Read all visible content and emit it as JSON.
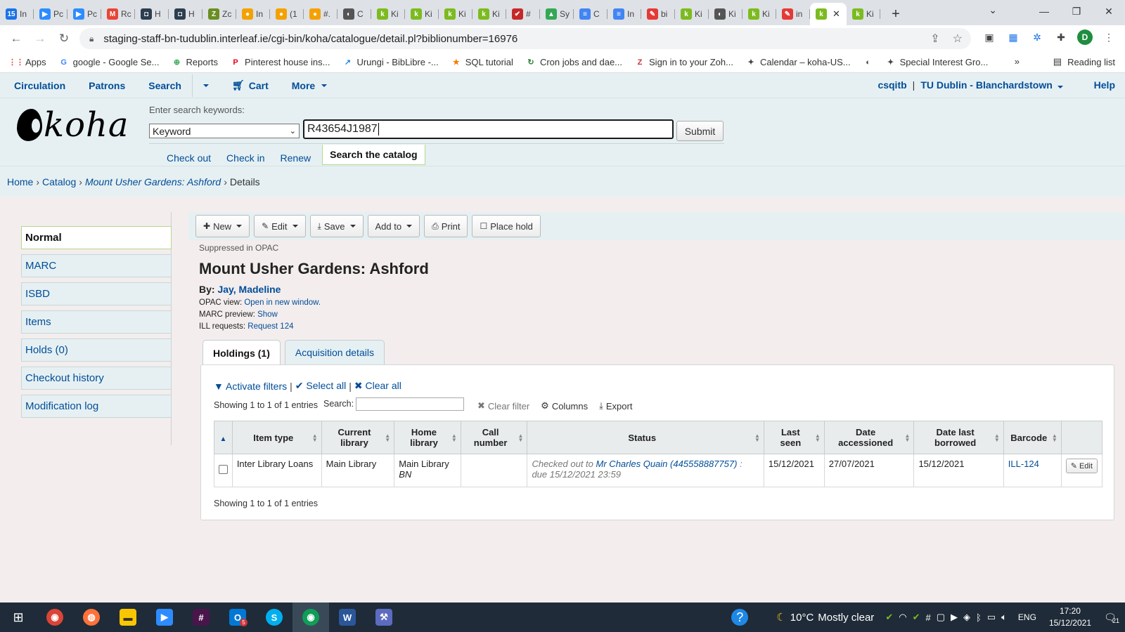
{
  "browser": {
    "tabs": [
      {
        "label": "In",
        "icon": "calendar-icon",
        "color": "#1a73e8",
        "glyph": "15"
      },
      {
        "label": "Pc",
        "icon": "zoom-icon",
        "color": "#2d8cff",
        "glyph": "▶"
      },
      {
        "label": "Pc",
        "icon": "zoom-icon",
        "color": "#2d8cff",
        "glyph": "▶"
      },
      {
        "label": "Rc",
        "icon": "gmail-icon",
        "color": "#ea4335",
        "glyph": "M"
      },
      {
        "label": "H",
        "icon": "app-icon",
        "color": "#2c3e50",
        "glyph": "◘"
      },
      {
        "label": "H",
        "icon": "app-icon",
        "color": "#2c3e50",
        "glyph": "◘"
      },
      {
        "label": "Zc",
        "icon": "zotero-icon",
        "color": "#6b8e23",
        "glyph": "Z"
      },
      {
        "label": "In",
        "icon": "circle-icon",
        "color": "#f4a100",
        "glyph": "●"
      },
      {
        "label": "(1",
        "icon": "circle-icon",
        "color": "#f4a100",
        "glyph": "●"
      },
      {
        "label": "#.",
        "icon": "circle-icon",
        "color": "#f4a100",
        "glyph": "●"
      },
      {
        "label": "C",
        "icon": "globe-icon",
        "color": "#555555",
        "glyph": "◐"
      },
      {
        "label": "Ki",
        "icon": "koha-icon",
        "color": "#7cbb1f",
        "glyph": "k"
      },
      {
        "label": "Ki",
        "icon": "koha-icon",
        "color": "#7cbb1f",
        "glyph": "k"
      },
      {
        "label": "Ki",
        "icon": "koha-icon",
        "color": "#7cbb1f",
        "glyph": "k"
      },
      {
        "label": "Ki",
        "icon": "koha-icon",
        "color": "#7cbb1f",
        "glyph": "k"
      },
      {
        "label": "#",
        "icon": "check-icon",
        "color": "#c62828",
        "glyph": "✔"
      },
      {
        "label": "Sy",
        "icon": "drive-icon",
        "color": "#34a853",
        "glyph": "▲"
      },
      {
        "label": "C",
        "icon": "docs-icon",
        "color": "#4285f4",
        "glyph": "≡"
      },
      {
        "label": "In",
        "icon": "docs-icon",
        "color": "#4285f4",
        "glyph": "≡"
      },
      {
        "label": "bi",
        "icon": "feather-icon",
        "color": "#e53935",
        "glyph": "✎"
      },
      {
        "label": "Ki",
        "icon": "koha-icon",
        "color": "#7cbb1f",
        "glyph": "k"
      },
      {
        "label": "Ki",
        "icon": "globe-icon",
        "color": "#555555",
        "glyph": "◐"
      },
      {
        "label": "Ki",
        "icon": "koha-icon",
        "color": "#7cbb1f",
        "glyph": "k"
      },
      {
        "label": "in",
        "icon": "feather-icon",
        "color": "#e53935",
        "glyph": "✎"
      },
      {
        "label": "",
        "icon": "koha-icon",
        "color": "#7cbb1f",
        "glyph": "k",
        "active": true
      },
      {
        "label": "Ki",
        "icon": "koha-icon",
        "color": "#7cbb1f",
        "glyph": "k"
      }
    ],
    "url": "staging-staff-bn-tudublin.interleaf.ie/cgi-bin/koha/catalogue/detail.pl?biblionumber=16976",
    "bookmarks": [
      {
        "label": "Apps",
        "icon": "apps-grid-icon",
        "color": "#ea4335",
        "glyph": "⋮⋮"
      },
      {
        "label": "google - Google Se...",
        "icon": "google-icon",
        "color": "#4285f4",
        "glyph": "G"
      },
      {
        "label": "Reports",
        "icon": "reports-icon",
        "color": "#34a853",
        "glyph": "⊕"
      },
      {
        "label": "Pinterest house ins...",
        "icon": "pinterest-icon",
        "color": "#e60023",
        "glyph": "P"
      },
      {
        "label": "Urungi - BibLibre -...",
        "icon": "urungi-icon",
        "color": "#1e88e5",
        "glyph": "↗"
      },
      {
        "label": "SQL tutorial",
        "icon": "star-icon",
        "color": "#f57c00",
        "glyph": "★"
      },
      {
        "label": "Cron jobs and dae...",
        "icon": "cron-icon",
        "color": "#2e7d32",
        "glyph": "↻"
      },
      {
        "label": "Sign in to your Zoh...",
        "icon": "zoho-icon",
        "color": "#d32f2f",
        "glyph": "Z"
      },
      {
        "label": "Calendar – koha-US...",
        "icon": "kohaus-icon",
        "color": "#444444",
        "glyph": "✦"
      },
      {
        "label": "",
        "icon": "globe-icon",
        "color": "#444444",
        "glyph": "◐"
      },
      {
        "label": "Special Interest Gro...",
        "icon": "kohaus-icon",
        "color": "#444444",
        "glyph": "✦"
      }
    ],
    "bookmarks_more": "»",
    "reading_list": "Reading list",
    "profile_initial": "D"
  },
  "koha": {
    "topnav": {
      "items": [
        "Circulation",
        "Patrons",
        "Search"
      ],
      "cart": "Cart",
      "more": "More",
      "user": "csqitb",
      "branch": "TU Dublin - Blanchardstown",
      "help": "Help"
    },
    "logo_text": "koha",
    "search": {
      "label": "Enter search keywords:",
      "index": "Keyword",
      "value": "R43654J1987",
      "submit": "Submit",
      "subtabs": [
        "Check out",
        "Check in",
        "Renew"
      ],
      "active_subtab": "Search the catalog"
    },
    "breadcrumbs": {
      "home": "Home",
      "catalog": "Catalog",
      "record": "Mount Usher Gardens: Ashford",
      "current": "Details"
    },
    "sidebar": [
      {
        "label": "Normal",
        "active": true
      },
      {
        "label": "MARC"
      },
      {
        "label": "ISBD"
      },
      {
        "label": "Items"
      },
      {
        "label": "Holds (0)"
      },
      {
        "label": "Checkout history"
      },
      {
        "label": "Modification log"
      }
    ],
    "toolbar": {
      "new": "New",
      "edit": "Edit",
      "save": "Save",
      "add_to": "Add to",
      "print": "Print",
      "place_hold": "Place hold"
    },
    "record": {
      "suppressed": "Suppressed in OPAC",
      "title": "Mount Usher Gardens: Ashford",
      "by_label": "By:",
      "author": "Jay, Madeline",
      "opac_label": "OPAC view:",
      "opac_link": "Open in new window.",
      "marc_label": "MARC preview:",
      "marc_link": "Show",
      "ill_label": "ILL requests:",
      "ill_link": "Request 124"
    },
    "tabs": [
      "Holdings (1)",
      "Acquisition details"
    ],
    "holdings": {
      "activate_filters": "Activate filters",
      "select_all": "Select all",
      "clear_all": "Clear all",
      "showing": "Showing 1 to 1 of 1 entries",
      "search_label": "Search:",
      "search_value": "",
      "clear_filter": "Clear filter",
      "columns": "Columns",
      "export": "Export",
      "headers": [
        "Item type",
        "Current library",
        "Home library",
        "Call number",
        "Status",
        "Last seen",
        "Date accessioned",
        "Date last borrowed",
        "Barcode"
      ],
      "row": {
        "item_type": "Inter Library Loans",
        "current_library": "Main Library",
        "home_library": "Main Library",
        "home_location": "BN",
        "call_number": "",
        "status_prefix": "Checked out to",
        "status_patron": "Mr Charles Quain (445558887757)",
        "status_sep": ":",
        "status_due": "due 15/12/2021 23:59",
        "last_seen": "15/12/2021",
        "date_accessioned": "27/07/2021",
        "date_last_borrowed": "15/12/2021",
        "barcode": "ILL-124",
        "edit": "Edit"
      }
    }
  },
  "taskbar": {
    "weather_temp": "10°C",
    "weather_text": "Mostly clear",
    "lang": "ENG",
    "time": "17:20",
    "date": "15/12/2021",
    "notifications": "21",
    "outlook_badge": "5"
  }
}
